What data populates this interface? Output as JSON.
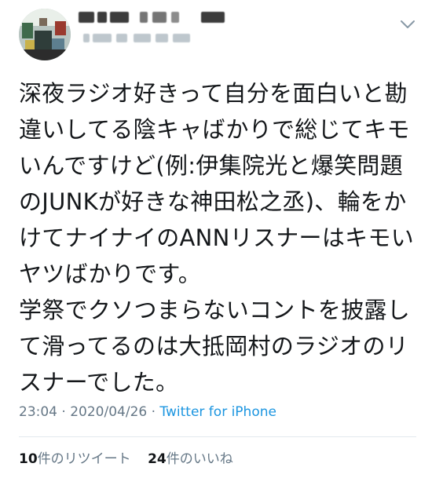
{
  "tweet": {
    "text": "深夜ラジオ好きって自分を面白いと勘違いしてる陰キャばかりで総じてキモいんですけど(例:伊集院光と爆笑問題のJUNKが好きな神田松之丞)、輪をかけてナイナイのANNリスナーはキモいヤツばかりです。\n学祭でクソつまらないコントを披露して滑ってるのは大抵岡村のラジオのリスナーでした。",
    "time": "23:04",
    "separator": " · ",
    "date": "2020/04/26",
    "source": "Twitter for iPhone"
  },
  "stats": {
    "retweets_count": "10",
    "retweets_label": "件のリツイート",
    "likes_count": "24",
    "likes_label": "件のいいね"
  },
  "icons": {
    "menu": "chevron-down-icon",
    "avatar": "profile-avatar"
  },
  "colors": {
    "text": "#14171a",
    "secondary": "#657786",
    "link": "#1b95e0",
    "divider": "#e1e8ed"
  }
}
